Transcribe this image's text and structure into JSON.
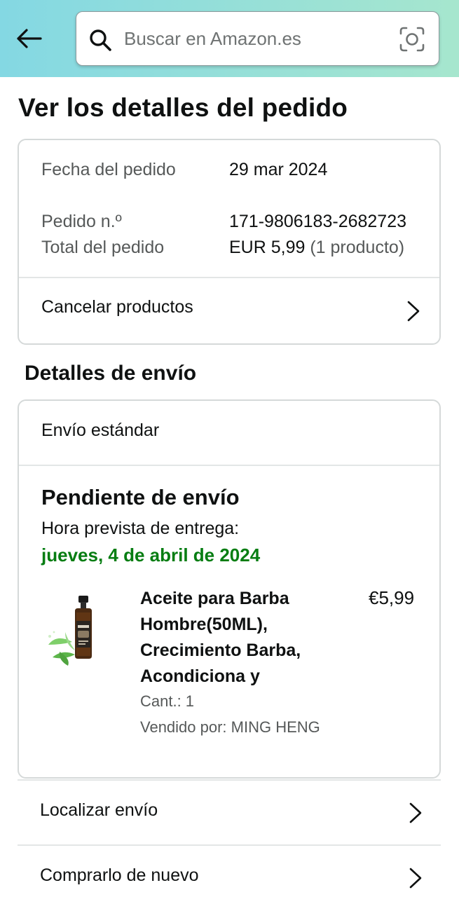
{
  "header": {
    "search_placeholder": "Buscar en Amazon.es",
    "back_icon": "arrow-left-icon",
    "search_icon": "magnifier-icon",
    "camera_icon": "camera-scan-icon",
    "gradient_start": "#84d8e3",
    "gradient_end": "#a6e6ce"
  },
  "page": {
    "title": "Ver los detalles del pedido"
  },
  "order": {
    "rows": [
      {
        "label": "Fecha del pedido",
        "value": "29 mar 2024"
      },
      {
        "label": "Pedido n.º",
        "value": "171-9806183-2682723"
      },
      {
        "label": "Total del pedido",
        "value": "EUR 5,99",
        "extra": " (1 producto)"
      }
    ],
    "cancel_label": "Cancelar productos"
  },
  "shipping": {
    "section_title": "Detalles de envío",
    "method": "Envío estándar",
    "status": "Pendiente de envío",
    "eta_label": "Hora prevista de entrega:",
    "eta_date": "jueves, 4 de abril de 2024",
    "eta_color": "#067d12",
    "product": {
      "name": "Aceite para Barba Hombre(50ML), Crecimiento Barba, Acondiciona y",
      "price": "€5,99",
      "quantity": "Cant.: 1",
      "seller": "Vendido por: MING HENG"
    }
  },
  "actions": {
    "track_label": "Localizar envío",
    "buy_again_label": "Comprarlo de nuevo"
  }
}
